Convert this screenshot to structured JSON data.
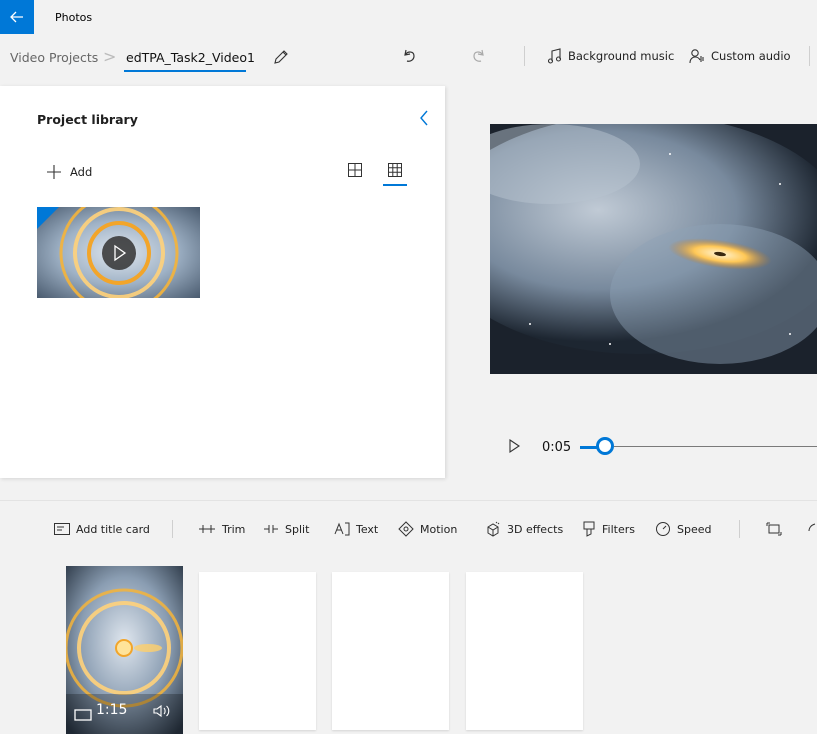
{
  "titlebar": {
    "app_title": "Photos",
    "back_icon": "back-arrow-icon",
    "accent": "#0078d7"
  },
  "breadcrumb": {
    "root": "Video Projects",
    "separator": ">",
    "current": "edTPA_Task2_Video1"
  },
  "commands": {
    "background_music": "Background music",
    "custom_audio": "Custom audio"
  },
  "library": {
    "title": "Project library",
    "add_label": "Add"
  },
  "player": {
    "time": "0:05",
    "progress_fraction": 0.02
  },
  "toolbar": {
    "add_title_card": "Add title card",
    "trim": "Trim",
    "split": "Split",
    "text": "Text",
    "motion": "Motion",
    "effects_3d": "3D effects",
    "filters": "Filters",
    "speed": "Speed"
  },
  "storyboard": {
    "clip_duration": "1:15"
  }
}
